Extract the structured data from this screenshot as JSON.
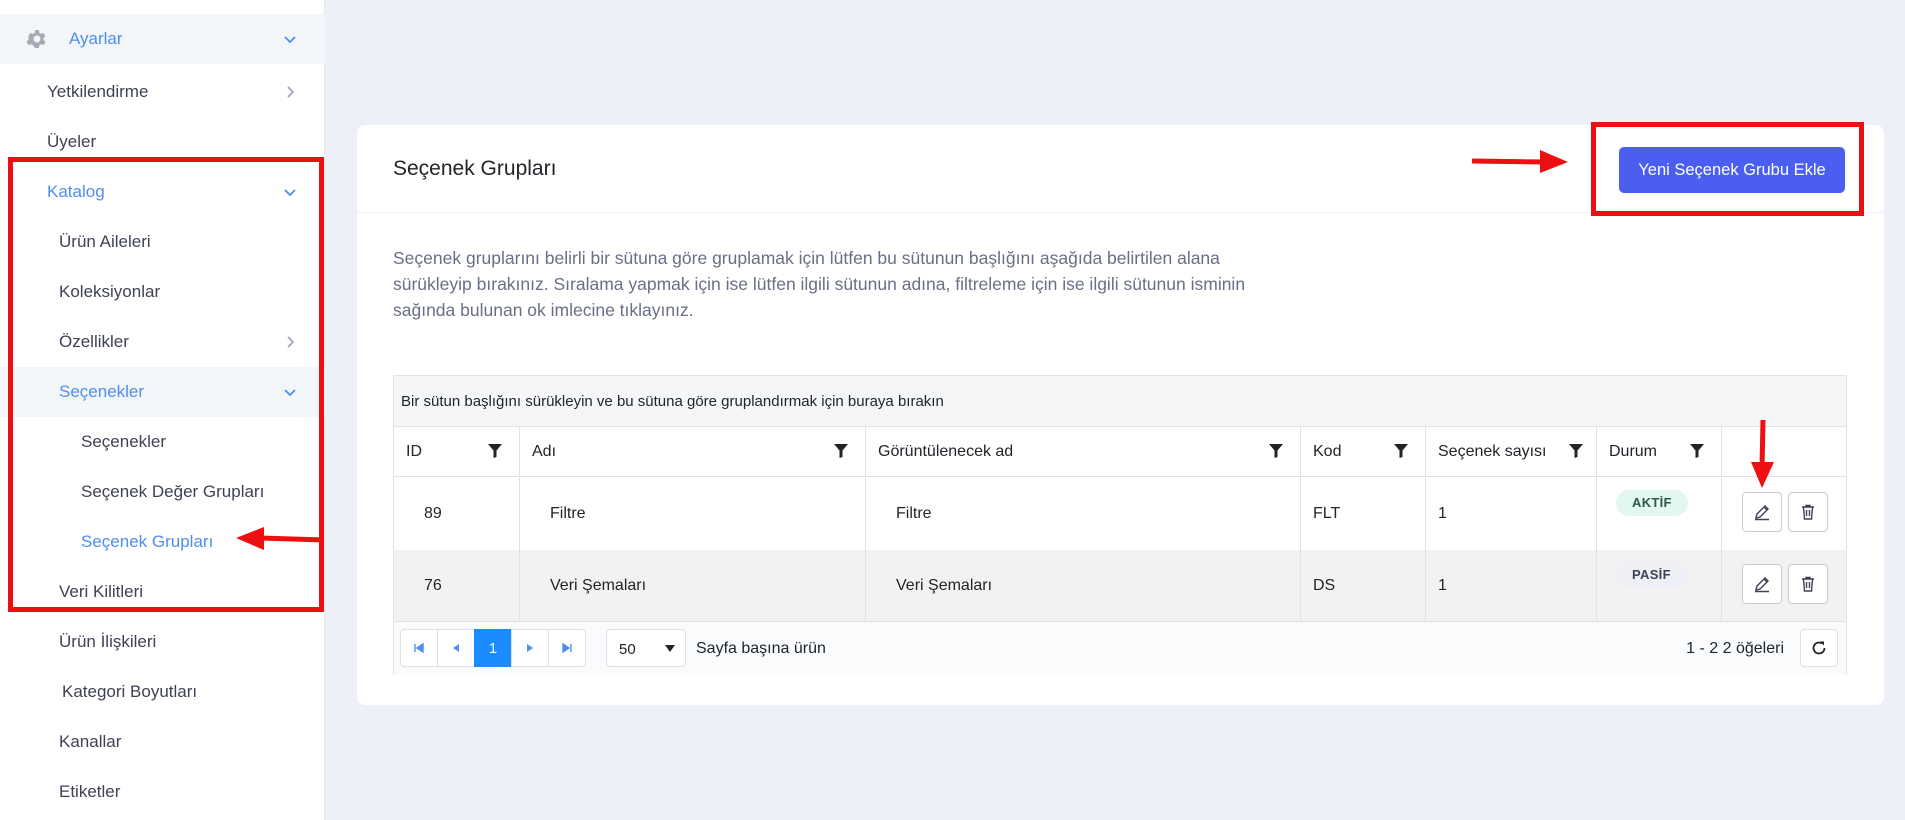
{
  "sidebar": {
    "settings": "Ayarlar",
    "authorization": "Yetkilendirme",
    "members": "Üyeler",
    "catalog": "Katalog",
    "product_families": "Ürün Aileleri",
    "collections": "Koleksiyonlar",
    "features": "Özellikler",
    "options": "Seçenekler",
    "options_sub": "Seçenekler",
    "option_value_groups": "Seçenek Değer Grupları",
    "option_groups": "Seçenek Grupları",
    "data_locks": "Veri Kilitleri",
    "product_relations": "Ürün İlişkileri",
    "category_dimensions": "Kategori Boyutları",
    "channels": "Kanallar",
    "tags": "Etiketler"
  },
  "card": {
    "title": "Seçenek Grupları",
    "add_button": "Yeni Seçenek Grubu Ekle",
    "description": "Seçenek gruplarını belirli bir sütuna göre gruplamak için lütfen bu sütunun başlığını aşağıda belirtilen alana sürükleyip bırakınız. Sıralama yapmak için ise lütfen ilgili sütunun adına, filtreleme için ise ilgili sütunun isminin sağında bulunan ok imlecine tıklayınız."
  },
  "grid": {
    "group_panel": "Bir sütun başlığını sürükleyin ve bu sütuna göre gruplandırmak için buraya bırakın",
    "columns": [
      "ID",
      "Adı",
      "Görüntülenecek ad",
      "Kod",
      "Seçenek sayısı",
      "Durum"
    ],
    "rows": [
      {
        "id": "89",
        "name": "Filtre",
        "display_name": "Filtre",
        "code": "FLT",
        "count": "1",
        "status": "AKTİF"
      },
      {
        "id": "76",
        "name": "Veri Şemaları",
        "display_name": "Veri Şemaları",
        "code": "DS",
        "count": "1",
        "status": "PASİF"
      }
    ],
    "pager": {
      "current_page": "1",
      "page_size": "50",
      "page_size_label": "Sayfa başına ürün",
      "info": "1 - 2 2 öğeleri"
    }
  },
  "colors": {
    "accent": "#4a5ff0",
    "link_blue": "#4d8ef0",
    "annotation_red": "#ee0f10",
    "page_bg": "#eef0f8"
  },
  "icons": [
    "gear-icon",
    "chevron-down-icon",
    "chevron-right-icon",
    "filter-icon",
    "edit-icon",
    "trash-icon",
    "first-page-icon",
    "prev-page-icon",
    "next-page-icon",
    "last-page-icon",
    "refresh-icon",
    "dropdown-arrow-icon"
  ]
}
